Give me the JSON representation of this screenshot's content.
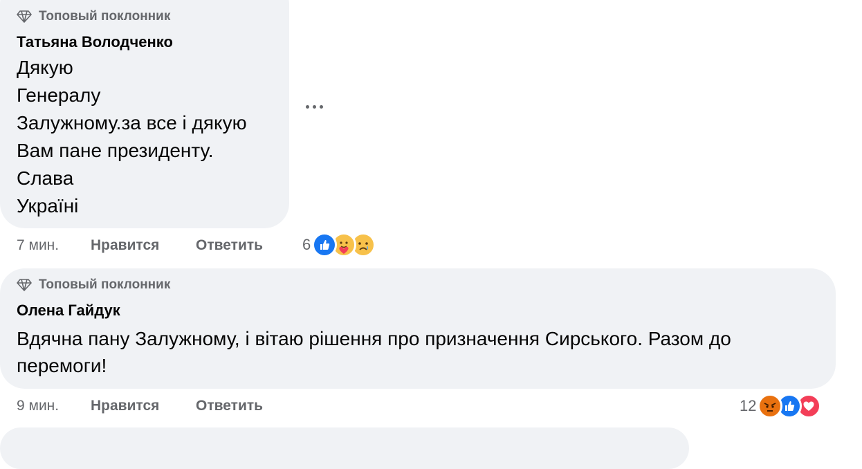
{
  "comments": [
    {
      "badge": "Топовый поклонник",
      "author": "Татьяна Володченко",
      "lines": [
        "Дякую",
        "Генералу",
        "Залужному.за все і дякую",
        "Вам пане президенту.",
        "Слава",
        "Україні"
      ],
      "time": "7 мин.",
      "like_label": "Нравится",
      "reply_label": "Ответить",
      "reaction_count": "6",
      "reactions": [
        "like-icon",
        "care-icon",
        "sad-icon"
      ]
    },
    {
      "badge": "Топовый поклонник",
      "author": "Олена Гайдук",
      "lines": [
        "Вдячна пану Залужному, і вітаю рішення про призначення Сирського. Разом до перемоги!"
      ],
      "time": "9 мин.",
      "like_label": "Нравится",
      "reply_label": "Ответить",
      "reaction_count": "12",
      "reactions": [
        "angry-icon",
        "like-icon",
        "love-icon"
      ]
    }
  ],
  "colors": {
    "bubble": "#f0f2f5",
    "meta_text": "#65676b",
    "like_blue": "#1877f2",
    "love_red": "#f33e58",
    "emoji_yellow": "#f7c14a",
    "angry_orange": "#e9710f"
  }
}
